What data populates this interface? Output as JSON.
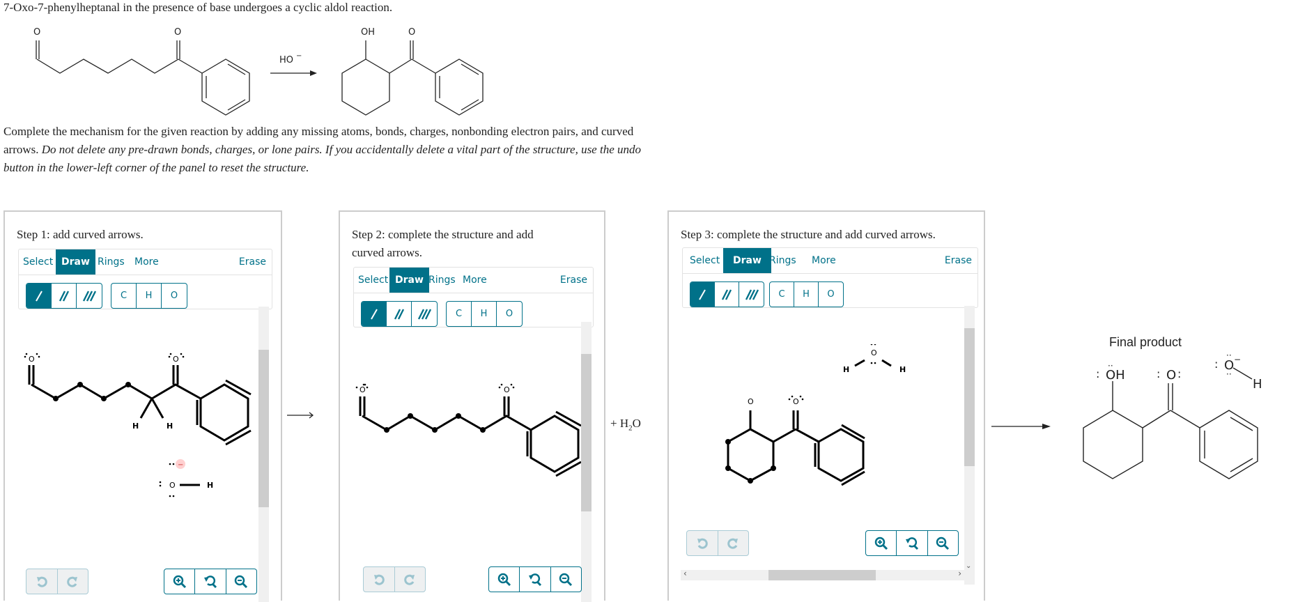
{
  "question": {
    "title": "7-Oxo-7-phenylheptanal in the presence of base undergoes a cyclic aldol reaction.",
    "scheme": {
      "reactant_atoms": {
        "aldehyde_o": "O",
        "ketone_o": "O"
      },
      "reagent": "HO",
      "reagent_charge": "−",
      "product_atoms": {
        "hydroxyl": "OH",
        "ketone_o": "O"
      }
    },
    "instructions_plain": "Complete the mechanism for the given reaction by adding any missing atoms, bonds, charges, nonbonding electron pairs, and curved arrows.",
    "instructions_italic": "Do not delete any pre-drawn bonds, charges, or lone pairs. If you accidentally delete a vital part of the structure, use the undo button in the lower-left corner of the panel to reset the structure."
  },
  "toolbar": {
    "tabs": [
      "Select",
      "Draw",
      "Rings",
      "More"
    ],
    "active_tab": "Draw",
    "erase": "Erase",
    "bond_buttons": [
      "single-bond",
      "double-bond",
      "triple-bond"
    ],
    "active_bond": "single-bond",
    "atom_buttons": [
      "C",
      "H",
      "O"
    ]
  },
  "panels": [
    {
      "step": "Step 1: add curved arrows.",
      "atoms": {
        "o1": "O",
        "o2": "O",
        "h1": "H",
        "h2": "H",
        "hydroxide_o": "O",
        "hydroxide_h": "H",
        "charge": "−"
      }
    },
    {
      "step": "Step 2: complete the structure and add curved arrows.",
      "atoms": {
        "o1": "O",
        "o2": "O"
      }
    },
    {
      "step": "Step 3: complete the structure and add curved arrows.",
      "atoms": {
        "o_ring": "O",
        "o_ketone": "O",
        "water_o": "O",
        "water_h1": "H",
        "water_h2": "H"
      }
    }
  ],
  "byproduct": {
    "plus": "+ H",
    "sub": "2",
    "tail": "O"
  },
  "final": {
    "label": "Final product",
    "oh": "OH",
    "ketone_o": "O",
    "hydroxide_o": "O",
    "hydroxide_h": "H",
    "hydroxide_charge": "−"
  },
  "colors": {
    "accent": "#007189",
    "panel_border": "#cccccc",
    "disabled_bg": "#eef0f1",
    "charge_bg": "#ffd0d0"
  }
}
